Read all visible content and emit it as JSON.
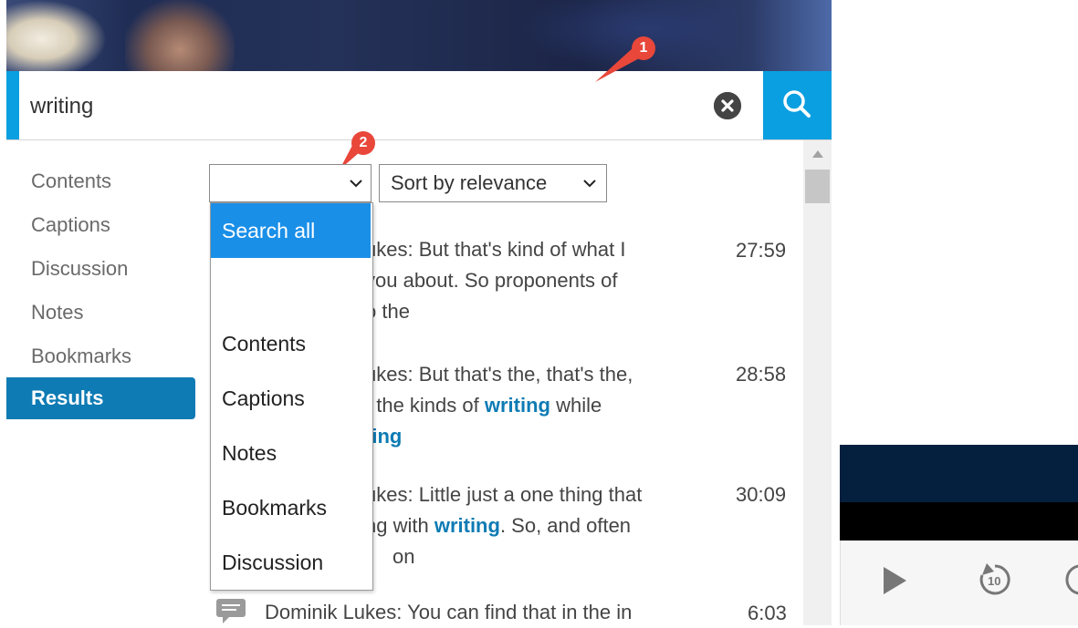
{
  "search": {
    "value": "writing",
    "clear_icon": "close-circle-icon",
    "search_icon": "search-icon",
    "accent_color": "#0a9fe0"
  },
  "annotations": [
    "1",
    "2"
  ],
  "sidebar": {
    "items": [
      {
        "label": "Contents"
      },
      {
        "label": "Captions"
      },
      {
        "label": "Discussion"
      },
      {
        "label": "Notes"
      },
      {
        "label": "Bookmarks"
      },
      {
        "label": "Results",
        "active": true
      }
    ]
  },
  "filters": {
    "type_select_value": "",
    "sort_label": "Sort by relevance"
  },
  "dropdown": {
    "options": [
      "Search all",
      "",
      "Contents",
      "Captions",
      "Notes",
      "Bookmarks",
      "Discussion"
    ],
    "selected": "Search all"
  },
  "results": [
    {
      "line1": "ukes: But that's kind of what I",
      "line2": " you about. So proponents of",
      "line3": "o the",
      "time": "27:59"
    },
    {
      "line1": "ukes: But that's the, that's the,",
      "line2_pre": "t the kinds of ",
      "line2_hl": "writing",
      "line2_post": " while",
      "line3_hl": "ting",
      "time": "28:58"
    },
    {
      "line1": "ukes: Little just a one thing that",
      "line2_pre": "ng with ",
      "line2_hl": "writing",
      "line2_post": ". So, and often",
      "line3": "on",
      "time": "30:09"
    },
    {
      "line1": "Dominik Lukes: You can find that in the in",
      "time": "6:03",
      "icon": "comment-icon"
    }
  ],
  "player": {
    "play_icon": "play-icon",
    "rewind_icon": "rewind-10-icon",
    "rewind_label": "10",
    "forward_icon": "forward-icon"
  }
}
